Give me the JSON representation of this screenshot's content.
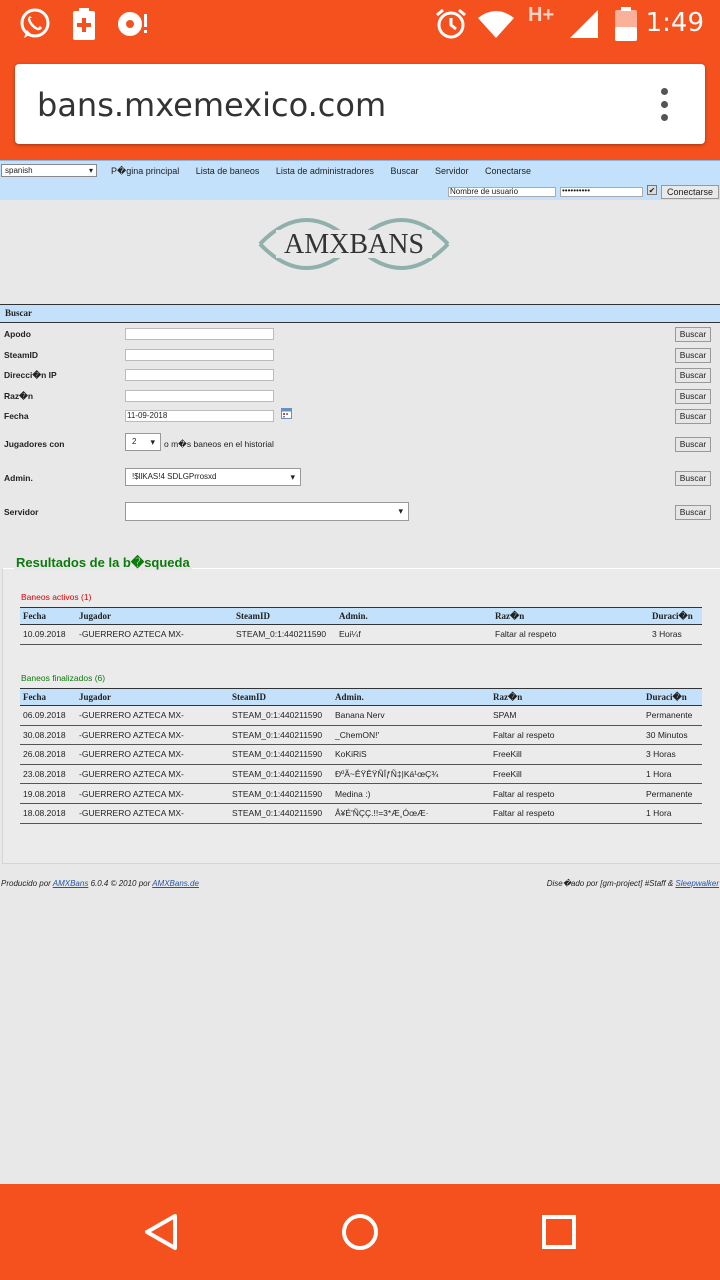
{
  "status_bar": {
    "time": "1:49",
    "network": "H+",
    "icons": [
      "whatsapp-icon",
      "battery-saver-icon",
      "speed-dial-icon",
      "alarm-icon",
      "wifi-icon",
      "signal-icon",
      "battery-icon"
    ]
  },
  "browser": {
    "url": "bans.mxemexico.com",
    "menu_icon": "more-vert-icon"
  },
  "topnav": {
    "language": "spanish",
    "links": [
      "P�gina principal",
      "Lista de baneos",
      "Lista de administradores",
      "Buscar",
      "Servidor",
      "Conectarse"
    ],
    "username_placeholder": "Nombre de usuario",
    "password_value": "••••••••••",
    "remember_checked": true,
    "connect_label": "Conectarse"
  },
  "logo": {
    "text": "AMXBANS"
  },
  "search": {
    "header": "Buscar",
    "button_label": "Buscar",
    "fields": {
      "apodo": {
        "label": "Apodo",
        "value": ""
      },
      "steamid": {
        "label": "SteamID",
        "value": ""
      },
      "ip": {
        "label": "Direcci�n IP",
        "value": ""
      },
      "razon": {
        "label": "Raz�n",
        "value": ""
      },
      "fecha": {
        "label": "Fecha",
        "value": "11-09-2018"
      },
      "jugadores": {
        "label": "Jugadores con",
        "count": "2",
        "suffix": "o m�s baneos en el historial"
      },
      "admin": {
        "label": "Admin.",
        "value": "!$llKAS!4 SDLGPrrosxd"
      },
      "servidor": {
        "label": "Servidor",
        "value": ""
      }
    }
  },
  "results": {
    "title": "Resultados de la b�squeda",
    "active": {
      "title": "Baneos activos (1)",
      "headers": [
        "Fecha",
        "Jugador",
        "SteamID",
        "Admin.",
        "Raz�n",
        "Duraci�n"
      ],
      "rows": [
        [
          "10.09.2018",
          "-GUERRERO AZTECA MX-",
          "STEAM_0:1:440211590",
          "Eui¼f",
          "Faltar al respeto",
          "3 Horas"
        ]
      ]
    },
    "finished": {
      "title": "Baneos finalizados (6)",
      "headers": [
        "Fecha",
        "Jugador",
        "SteamID",
        "Admin.",
        "Raz�n",
        "Duraci�n"
      ],
      "rows": [
        [
          "06.09.2018",
          "-GUERRERO AZTECA MX-",
          "STEAM_0:1:440211590",
          "Banana Nerv",
          "SPAM",
          "Permanente"
        ],
        [
          "30.08.2018",
          "-GUERRERO AZTECA MX-",
          "STEAM_0:1:440211590",
          "_ChemON!'",
          "Faltar al respeto",
          "30 Minutos"
        ],
        [
          "26.08.2018",
          "-GUERRERO AZTECA MX-",
          "STEAM_0:1:440211590",
          "KoKiRiS",
          "FreeKill",
          "3 Horas"
        ],
        [
          "23.08.2018",
          "-GUERRERO AZTECA MX-",
          "STEAM_0:1:440211590",
          "ÐºÃ~ÊŸÊŸÑÎƒÑ‡|Ká¹œÇ¾",
          "FreeKill",
          "1 Hora"
        ],
        [
          "19.08.2018",
          "-GUERRERO AZTECA MX-",
          "STEAM_0:1:440211590",
          "Medina :)",
          "Faltar al respeto",
          "Permanente"
        ],
        [
          "18.08.2018",
          "-GUERRERO AZTECA MX-",
          "STEAM_0:1:440211590",
          "Å¥É'ÑÇÇ.!!=3*Æ¸ÓœÆ·",
          "Faltar al respeto",
          "1 Hora"
        ]
      ]
    }
  },
  "footer": {
    "left_prefix": "Producido por",
    "left_link1": "AMXBans",
    "left_middle": "6.0.4 © 2010 por",
    "left_link2": "AMXBans.de",
    "right_prefix": "Dise�ado por [gm-project] #Staff &",
    "right_link": "Sleepwalker"
  },
  "navbar": {
    "icons": [
      "back-icon",
      "home-icon",
      "recents-icon"
    ]
  }
}
